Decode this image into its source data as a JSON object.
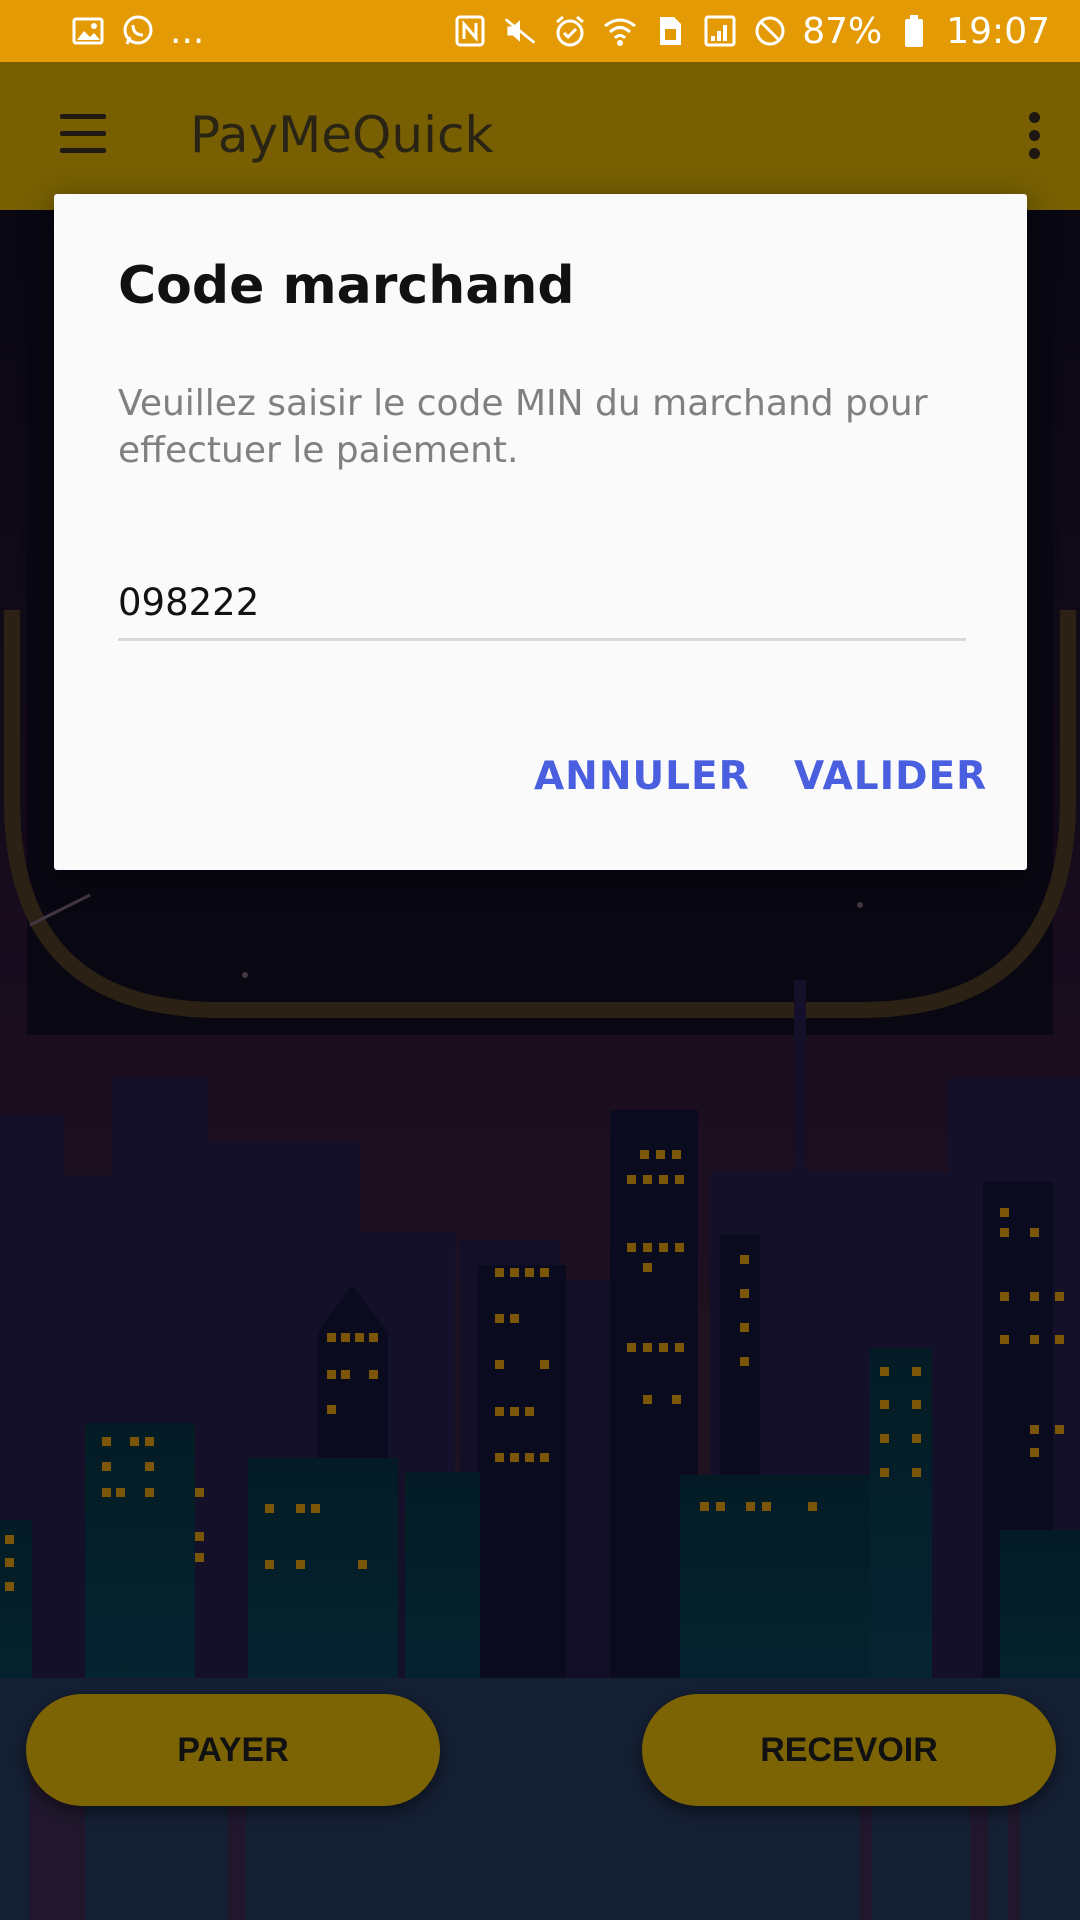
{
  "status_bar": {
    "left_icons": [
      "gallery-icon",
      "whatsapp-icon"
    ],
    "ellipsis": "...",
    "right_icons": [
      "nfc-icon",
      "mute-icon",
      "alarm-icon",
      "wifi-icon",
      "sim-icon",
      "signal-icon",
      "dnd-icon",
      "battery-icon"
    ],
    "battery": "87%",
    "time": "19:07"
  },
  "app_bar": {
    "title": "PayMeQuick",
    "menu_icon": "hamburger-menu-icon",
    "overflow_icon": "more-vertical-icon",
    "background": "#775f02"
  },
  "dialog": {
    "title": "Code marchand",
    "message": "Veuillez saisir le code MIN du marchand pour effectuer le paiement.",
    "input_value": "098222",
    "cancel_label": "ANNULER",
    "confirm_label": "VALIDER",
    "button_color": "#4a5fe0"
  },
  "actions": {
    "pay_label": "PAYER",
    "receive_label": "RECEVOIR",
    "button_color": "#7c6405"
  },
  "colors": {
    "status_bar": "#e39a04",
    "window_lights": "#a5730a"
  }
}
